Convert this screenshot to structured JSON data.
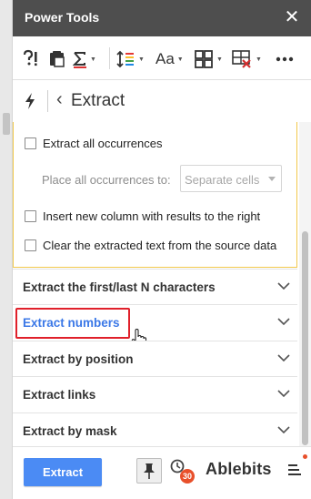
{
  "app": {
    "title": "Power Tools",
    "close_glyph": "✕"
  },
  "toolbar": {
    "icons": [
      "quick-tools-icon",
      "paste-special-icon",
      "sigma-icon",
      "line-spacing-icon",
      "text-case-icon",
      "split-merge-icon",
      "clear-cells-icon",
      "more-icon"
    ]
  },
  "header": {
    "back_glyph": "‹",
    "title": "Extract"
  },
  "options": {
    "extract_all": "Extract all occurrences",
    "place_label": "Place all occurrences to:",
    "place_value": "Separate cells",
    "insert_column": "Insert new column with results to the right",
    "clear_source": "Clear the extracted text from the source data"
  },
  "sections": [
    {
      "label": "Extract the first/last N characters"
    },
    {
      "label": "Extract numbers",
      "active": true
    },
    {
      "label": "Extract by position"
    },
    {
      "label": "Extract links"
    },
    {
      "label": "Extract by mask"
    }
  ],
  "footer": {
    "extract_button": "Extract",
    "history_badge": "30",
    "brand": "Ablebits"
  },
  "colors": {
    "titlebar": "#4e4e4e",
    "primary_button": "#4b8bf4",
    "active_link": "#3b78e7",
    "highlight": "#e0202a",
    "options_border": "#f2c94c",
    "badge": "#e8502b"
  }
}
